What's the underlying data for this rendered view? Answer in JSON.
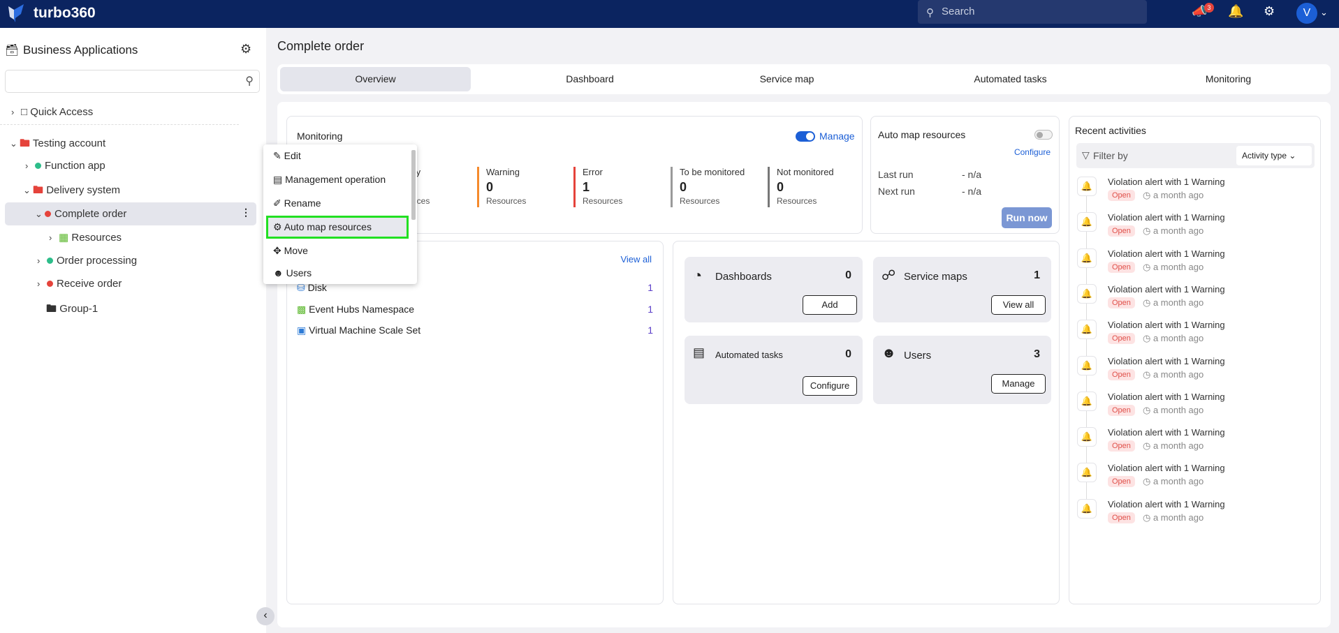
{
  "topbar": {
    "brand": "turbo360",
    "search_placeholder": "Search",
    "notifications_badge": "3",
    "avatar_initial": "V"
  },
  "sidebar": {
    "title": "Business Applications",
    "search_placeholder": "",
    "quick_access": "Quick Access",
    "tree": [
      {
        "label": "Testing account",
        "status": "folder"
      },
      {
        "label": "Function app",
        "status": "#2dbd8a"
      },
      {
        "label": "Delivery system",
        "status": "folder"
      },
      {
        "label": "Complete order",
        "status": "#e5433b",
        "selected": true
      },
      {
        "label": "Resources",
        "status": "grid"
      },
      {
        "label": "Order processing",
        "status": "#2dbd8a"
      },
      {
        "label": "Receive order",
        "status": "#e5433b"
      },
      {
        "label": "Group-1",
        "status": "folder"
      }
    ]
  },
  "context_menu": {
    "items": [
      {
        "label": "Edit",
        "icon": "edit-icon"
      },
      {
        "label": "Management operation",
        "icon": "server-icon"
      },
      {
        "label": "Rename",
        "icon": "pencil-icon"
      },
      {
        "label": "Auto map resources",
        "icon": "gears-icon",
        "highlighted": true
      },
      {
        "label": "Move",
        "icon": "move-icon"
      },
      {
        "label": "Users",
        "icon": "users-icon"
      }
    ]
  },
  "main": {
    "title": "Complete order",
    "tabs": [
      "Overview",
      "Dashboard",
      "Service map",
      "Automated tasks",
      "Monitoring"
    ],
    "active_tab": "Overview",
    "monitoring": {
      "title": "Monitoring",
      "manage": "Manage",
      "toggle_on": true,
      "stats": [
        {
          "label": "Healthy",
          "value": "",
          "unit": "Resources",
          "color": "#2dbd8a"
        },
        {
          "label": "Warning",
          "value": "0",
          "unit": "Resources",
          "color": "#f58a2c"
        },
        {
          "label": "Error",
          "value": "1",
          "unit": "Resources",
          "color": "#e5433b"
        },
        {
          "label": "To be monitored",
          "value": "0",
          "unit": "Resources",
          "color": "#9a9a9a"
        },
        {
          "label": "Not monitored",
          "value": "0",
          "unit": "Resources",
          "color": "#777777"
        }
      ]
    },
    "auto_map": {
      "title": "Auto map resources",
      "toggle_on": false,
      "configure": "Configure",
      "last_run_label": "Last run",
      "last_run": "- n/a",
      "next_run_label": "Next run",
      "next_run": "- n/a",
      "run_now": "Run now"
    },
    "resources": {
      "view_all": "View all",
      "rows": [
        {
          "name": "Disk",
          "count": "1"
        },
        {
          "name": "Event Hubs Namespace",
          "count": "1"
        },
        {
          "name": "Virtual Machine Scale Set",
          "count": "1"
        }
      ]
    },
    "tiles": {
      "dashboards": {
        "label": "Dashboards",
        "count": "0",
        "button": "Add"
      },
      "service_maps": {
        "label": "Service maps",
        "count": "1",
        "button": "View all"
      },
      "automated_tasks": {
        "label": "Automated tasks",
        "count": "0",
        "button": "Configure"
      },
      "users": {
        "label": "Users",
        "count": "3",
        "button": "Manage"
      }
    },
    "recent": {
      "title": "Recent activities",
      "filter_by": "Filter by",
      "activity_type": "Activity type",
      "items": [
        {
          "title": "Violation alert with 1 Warning",
          "status": "Open",
          "time": "a month ago"
        },
        {
          "title": "Violation alert with 1 Warning",
          "status": "Open",
          "time": "a month ago"
        },
        {
          "title": "Violation alert with 1 Warning",
          "status": "Open",
          "time": "a month ago"
        },
        {
          "title": "Violation alert with 1 Warning",
          "status": "Open",
          "time": "a month ago"
        },
        {
          "title": "Violation alert with 1 Warning",
          "status": "Open",
          "time": "a month ago"
        },
        {
          "title": "Violation alert with 1 Warning",
          "status": "Open",
          "time": "a month ago"
        },
        {
          "title": "Violation alert with 1 Warning",
          "status": "Open",
          "time": "a month ago"
        },
        {
          "title": "Violation alert with 1 Warning",
          "status": "Open",
          "time": "a month ago"
        },
        {
          "title": "Violation alert with 1 Warning",
          "status": "Open",
          "time": "a month ago"
        },
        {
          "title": "Violation alert with 1 Warning",
          "status": "Open",
          "time": "a month ago"
        }
      ]
    }
  }
}
